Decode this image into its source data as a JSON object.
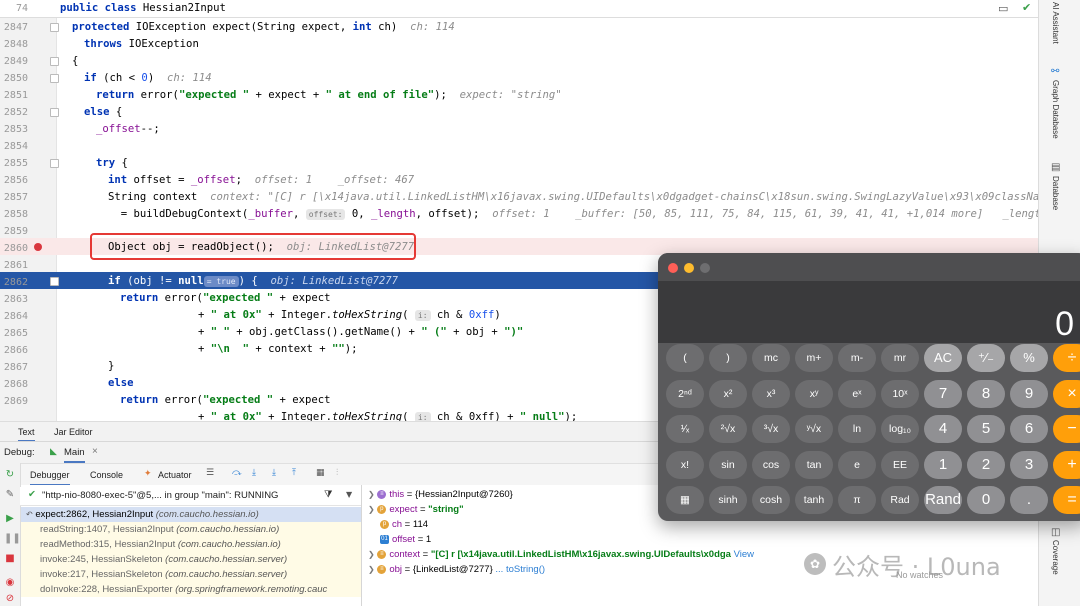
{
  "sticky": {
    "line": "74",
    "code_kw": "public class",
    "code_rest": " Hessian2Input"
  },
  "gutter_lines": [
    "2847",
    "2848",
    "2849",
    "2850",
    "2851",
    "2852",
    "2853",
    "2854",
    "2855",
    "2856",
    "2857",
    "2858",
    "2859",
    "2860",
    "2861",
    "2862",
    "2863",
    "2864",
    "2865",
    "2866",
    "2867",
    "2868",
    "2869"
  ],
  "code": {
    "l2847_kw": "protected",
    "l2847_a": " IOException expect(",
    "l2847_kw2": "String",
    "l2847_b": " expect, ",
    "l2847_kw3": "int",
    "l2847_c": " ch)  ",
    "l2847_hint": "ch: 114",
    "l2848_kw": "throws",
    "l2848_a": " IOException",
    "l2849": "{",
    "l2850_kw": "if",
    "l2850_a": " (ch < ",
    "l2850_num": "0",
    "l2850_b": ")  ",
    "l2850_hint": "ch: 114",
    "l2851_kw": "return",
    "l2851_a": " error(",
    "l2851_s1": "\"expected \"",
    "l2851_b": " + expect + ",
    "l2851_s2": "\" at end of file\"",
    "l2851_c": ");  ",
    "l2851_hint": "expect: \"string\"",
    "l2852_kw": "else",
    "l2852_a": " {",
    "l2853_f": "_offset",
    "l2853_a": "--;",
    "l2855_kw": "try",
    "l2855_a": " {",
    "l2856_kw": "int",
    "l2856_a": " offset = ",
    "l2856_f": "_offset",
    "l2856_b": ";  ",
    "l2856_hint": "offset: 1    _offset: 467",
    "l2857_a": "String context  ",
    "l2857_hint": "context: \"[C] r [\\x14java.util.LinkedListHM\\x16javax.swing.UIDefaults\\x0dgadget-chainsC\\x18sun.swing.SwingLazyValue\\x93\\x09className\\nmetho",
    "l2858_a": "  = buildDebugContext(",
    "l2858_f": "_buffer",
    "l2858_b": ", ",
    "l2858_pill": "offset:",
    "l2858_c": " 0, ",
    "l2858_f2": "_length",
    "l2858_d": ", offset);  ",
    "l2858_hint": "offset: 1    _buffer: [50, 85, 111, 75, 84, 115, 61, 39, 41, 41, +1,014 more]   _length: 467",
    "l2860_a": "Object obj = readObject();  ",
    "l2860_hint": "obj: LinkedList@7277",
    "l2862_kw": "if",
    "l2862_a": " (obj != ",
    "l2862_kw2": "null",
    "l2862_pill": "= true",
    "l2862_b": ") {  ",
    "l2862_hint": "obj: LinkedList@7277",
    "l2863_kw": "return",
    "l2863_a": " error(",
    "l2863_s1": "\"expected \"",
    "l2863_b": " + expect",
    "l2864_a": "+ ",
    "l2864_s1": "\" at 0x\"",
    "l2864_b": " + Integer.",
    "l2864_i": "toHexString",
    "l2864_c": "( ",
    "l2864_pill": "i:",
    "l2864_d": " ch & ",
    "l2864_num": "0xff",
    "l2864_e": ")",
    "l2865_a": "+ ",
    "l2865_s1": "\" \"",
    "l2865_b": " + obj.getClass().getName() + ",
    "l2865_s2": "\" (\"",
    "l2865_c": " + obj + ",
    "l2865_s3": "\")\"",
    "l2866_a": "+ ",
    "l2866_s1": "\"\\n  \"",
    "l2866_b": " + context + ",
    "l2866_s2": "\"\"",
    "l2866_c": ");",
    "l2867": "}",
    "l2868_kw": "else",
    "l2869_kw": "return",
    "l2869_a": " error(",
    "l2869_s1": "\"expected \"",
    "l2869_b": " + expect",
    "l2870_a": "+ ",
    "l2870_s1": "\" at 0x\"",
    "l2870_b": " + Integer.",
    "l2870_i": "toHexString",
    "l2870_c": "( ",
    "l2870_pill": "i:",
    "l2870_d": " ch & 0xff) + ",
    "l2870_s2": "\" null\"",
    "l2870_e": ");"
  },
  "right_tabs": [
    "AI Assistant",
    "Graph Database",
    "Database",
    "Coverage"
  ],
  "editor_tabs": {
    "text": "Text",
    "jar": "Jar Editor"
  },
  "debugbar": {
    "label": "Debug:",
    "config": "Main"
  },
  "debug_tabs": {
    "debugger": "Debugger",
    "console": "Console",
    "actuator": "Actuator"
  },
  "thread": {
    "label": "\"http-nio-8080-exec-5\"@5,... in group \"main\": RUNNING"
  },
  "frames": [
    {
      "m": "expect:2862, Hessian2Input",
      "p": "(com.caucho.hessian.io)"
    },
    {
      "m": "readString:1407, Hessian2Input",
      "p": "(com.caucho.hessian.io)"
    },
    {
      "m": "readMethod:315, Hessian2Input",
      "p": "(com.caucho.hessian.io)"
    },
    {
      "m": "invoke:245, HessianSkeleton",
      "p": "(com.caucho.hessian.server)"
    },
    {
      "m": "invoke:217, HessianSkeleton",
      "p": "(com.caucho.hessian.server)"
    },
    {
      "m": "doInvoke:228, HessianExporter",
      "p": "(org.springframework.remoting.cauc"
    }
  ],
  "vars": [
    {
      "name": "this",
      "val": " = {Hessian2Input@7260}"
    },
    {
      "name": "expect",
      "val": " = ",
      "str": "\"string\""
    },
    {
      "name": "ch",
      "val": " = 114"
    },
    {
      "name": "offset",
      "val": " = 1"
    },
    {
      "name": "context",
      "val": " = ",
      "str": "\"[C] r [\\x14java.util.LinkedListHM\\x16javax.swing.UIDefaults\\x0dga",
      "link": "View"
    },
    {
      "name": "obj",
      "val": " = {LinkedList@7277}",
      "link": "... toString()"
    }
  ],
  "watermark": {
    "text": "公众号 · L0una",
    "sub": "No watches"
  },
  "calculator": {
    "display": "0",
    "colors": {
      "op": "#ff9f0a",
      "body": "#5a5a5c"
    },
    "rows": [
      [
        "(",
        ")",
        "mc",
        "m+",
        "m-",
        "mr",
        "AC",
        "⁺∕₋",
        "%",
        "÷"
      ],
      [
        "2ⁿᵈ",
        "x²",
        "x³",
        "xʸ",
        "eˣ",
        "10ˣ",
        "7",
        "8",
        "9",
        "×"
      ],
      [
        "¹∕ₓ",
        "²√x",
        "³√x",
        "ʸ√x",
        "ln",
        "log₁₀",
        "4",
        "5",
        "6",
        "−"
      ],
      [
        "x!",
        "sin",
        "cos",
        "tan",
        "e",
        "EE",
        "1",
        "2",
        "3",
        "+"
      ],
      [
        "▦",
        "sinh",
        "cosh",
        "tanh",
        "π",
        "Rad",
        "Rand",
        "0",
        ".",
        "="
      ]
    ]
  }
}
